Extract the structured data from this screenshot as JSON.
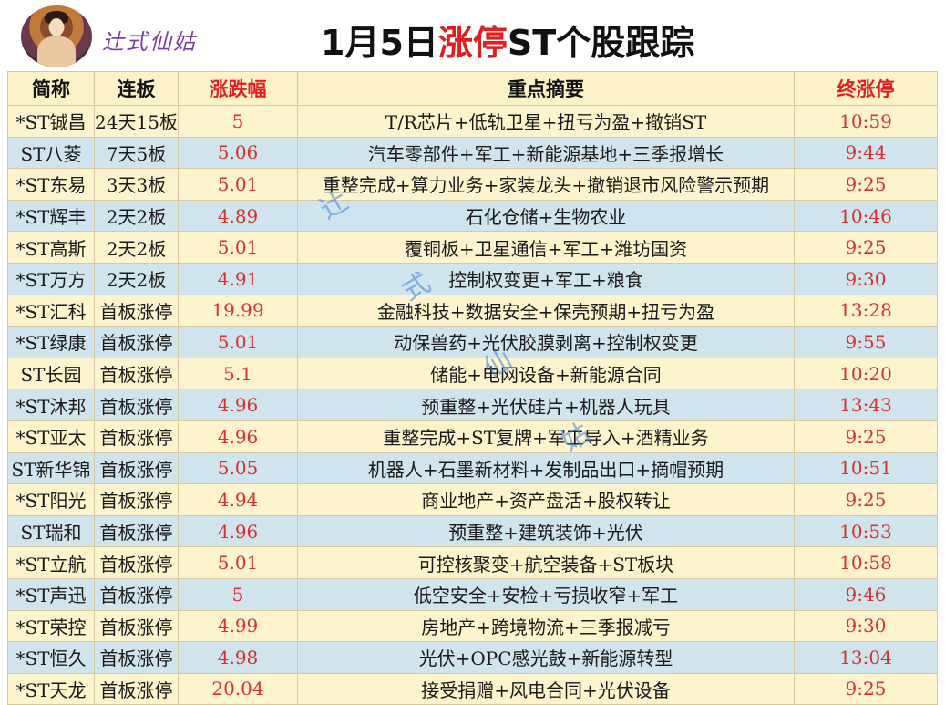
{
  "header": {
    "brand": "辻式仙姑",
    "title_prefix": "1月5日",
    "title_highlight": "涨停",
    "title_suffix": "ST个股跟踪"
  },
  "table": {
    "columns": [
      "简称",
      "连板",
      "涨跌幅",
      "重点摘要",
      "终涨停"
    ],
    "rows": [
      {
        "name": "*ST铖昌",
        "boards": "24天15板",
        "pct": "5",
        "summary": "T/R芯片+低轨卫星+扭亏为盈+撤销ST",
        "time": "10:59"
      },
      {
        "name": "ST八菱",
        "boards": "7天5板",
        "pct": "5.06",
        "summary": "汽车零部件+军工+新能源基地+三季报增长",
        "time": "9:44"
      },
      {
        "name": "*ST东易",
        "boards": "3天3板",
        "pct": "5.01",
        "summary": "重整完成+算力业务+家装龙头+撤销退市风险警示预期",
        "time": "9:25"
      },
      {
        "name": "*ST辉丰",
        "boards": "2天2板",
        "pct": "4.89",
        "summary": "石化仓储+生物农业",
        "time": "10:46"
      },
      {
        "name": "*ST高斯",
        "boards": "2天2板",
        "pct": "5.01",
        "summary": "覆铜板+卫星通信+军工+潍坊国资",
        "time": "9:25"
      },
      {
        "name": "*ST万方",
        "boards": "2天2板",
        "pct": "4.91",
        "summary": "控制权变更+军工+粮食",
        "time": "9:30"
      },
      {
        "name": "*ST汇科",
        "boards": "首板涨停",
        "pct": "19.99",
        "summary": "金融科技+数据安全+保壳预期+扭亏为盈",
        "time": "13:28"
      },
      {
        "name": "*ST绿康",
        "boards": "首板涨停",
        "pct": "5.01",
        "summary": "动保兽药+光伏胶膜剥离+控制权变更",
        "time": "9:55"
      },
      {
        "name": "ST长园",
        "boards": "首板涨停",
        "pct": "5.1",
        "summary": "储能+电网设备+新能源合同",
        "time": "10:20"
      },
      {
        "name": "*ST沐邦",
        "boards": "首板涨停",
        "pct": "4.96",
        "summary": "预重整+光伏硅片+机器人玩具",
        "time": "13:43"
      },
      {
        "name": "*ST亚太",
        "boards": "首板涨停",
        "pct": "4.96",
        "summary": "重整完成+ST复牌+军工导入+酒精业务",
        "time": "9:25"
      },
      {
        "name": "ST新华锦",
        "boards": "首板涨停",
        "pct": "5.05",
        "summary": "机器人+石墨新材料+发制品出口+摘帽预期",
        "time": "10:51"
      },
      {
        "name": "*ST阳光",
        "boards": "首板涨停",
        "pct": "4.94",
        "summary": "商业地产+资产盘活+股权转让",
        "time": "9:25"
      },
      {
        "name": "ST瑞和",
        "boards": "首板涨停",
        "pct": "4.96",
        "summary": "预重整+建筑装饰+光伏",
        "time": "10:53"
      },
      {
        "name": "*ST立航",
        "boards": "首板涨停",
        "pct": "5.01",
        "summary": "可控核聚变+航空装备+ST板块",
        "time": "10:58"
      },
      {
        "name": "*ST声迅",
        "boards": "首板涨停",
        "pct": "5",
        "summary": "低空安全+安检+亏损收窄+军工",
        "time": "9:46"
      },
      {
        "name": "*ST荣控",
        "boards": "首板涨停",
        "pct": "4.99",
        "summary": "房地产+跨境物流+三季报减亏",
        "time": "9:30"
      },
      {
        "name": "*ST恒久",
        "boards": "首板涨停",
        "pct": "4.98",
        "summary": "光伏+OPC感光鼓+新能源转型",
        "time": "13:04"
      },
      {
        "name": "*ST天龙",
        "boards": "首板涨停",
        "pct": "20.04",
        "summary": "接受捐赠+风电合同+光伏设备",
        "time": "9:25"
      }
    ]
  },
  "watermark": [
    "辻",
    "式",
    "仙",
    "姑"
  ]
}
